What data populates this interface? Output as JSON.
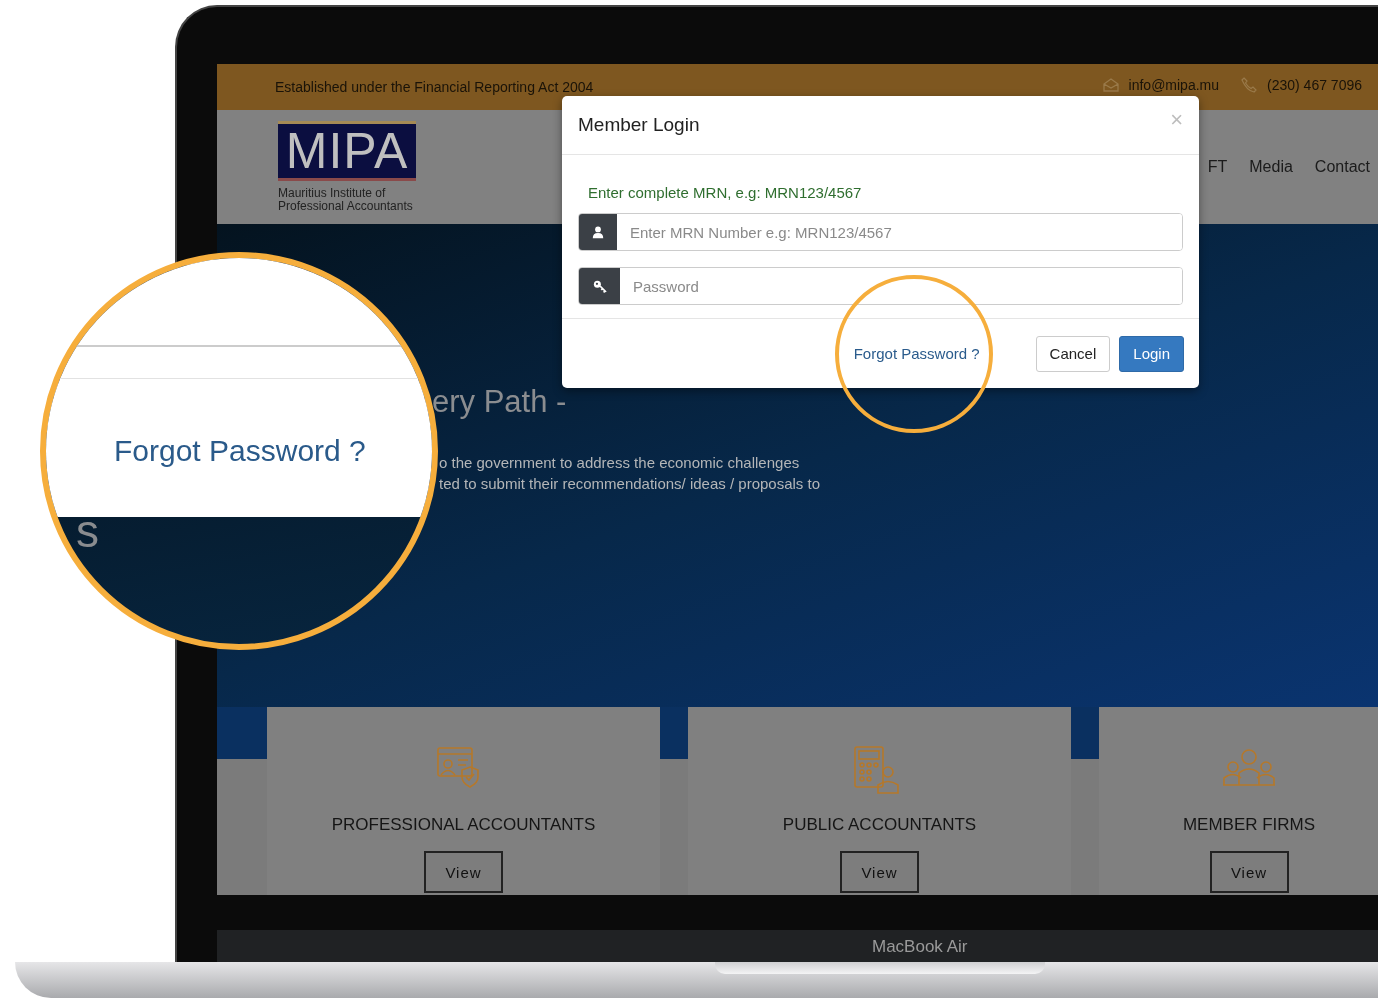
{
  "top_bar": {
    "tagline": "Established under the Financial Reporting Act 2004",
    "email": "info@mipa.mu",
    "phone": "(230) 467 7096"
  },
  "header": {
    "logo": {
      "mark": "MIPA",
      "subtitle_line_1": "Mauritius Institute of",
      "subtitle_line_2": "Professional Accountants"
    },
    "nav": [
      {
        "label": "FT"
      },
      {
        "label": "Media"
      },
      {
        "label": "Contact"
      }
    ]
  },
  "hero": {
    "title": "ery Path -",
    "text_lines": [
      "o the government to address the economic challenges",
      "ted to submit their recommendations/ ideas / proposals to"
    ]
  },
  "cards": [
    {
      "kind": "profile",
      "title": "PROFESSIONAL ACCOUNTANTS",
      "button": "View"
    },
    {
      "kind": "calculator",
      "title": "PUBLIC ACCOUNTANTS",
      "button": "View"
    },
    {
      "kind": "team",
      "title": "MEMBER FIRMS",
      "button": "View"
    }
  ],
  "modal": {
    "title": "Member Login",
    "close": "×",
    "hint": "Enter complete MRN, e.g: MRN123/4567",
    "fields": [
      {
        "kind": "user",
        "placeholder": "Enter MRN Number e.g: MRN123/4567"
      },
      {
        "kind": "key",
        "placeholder": "Password"
      }
    ],
    "forgot_link": "Forgot Password ?",
    "buttons": [
      {
        "kind": "default",
        "label": "Cancel"
      },
      {
        "kind": "primary",
        "label": "Login"
      }
    ]
  },
  "magnifier": {
    "link": "Forgot Password ?",
    "fragment": "s"
  },
  "device": {
    "label": "MacBook Air"
  }
}
